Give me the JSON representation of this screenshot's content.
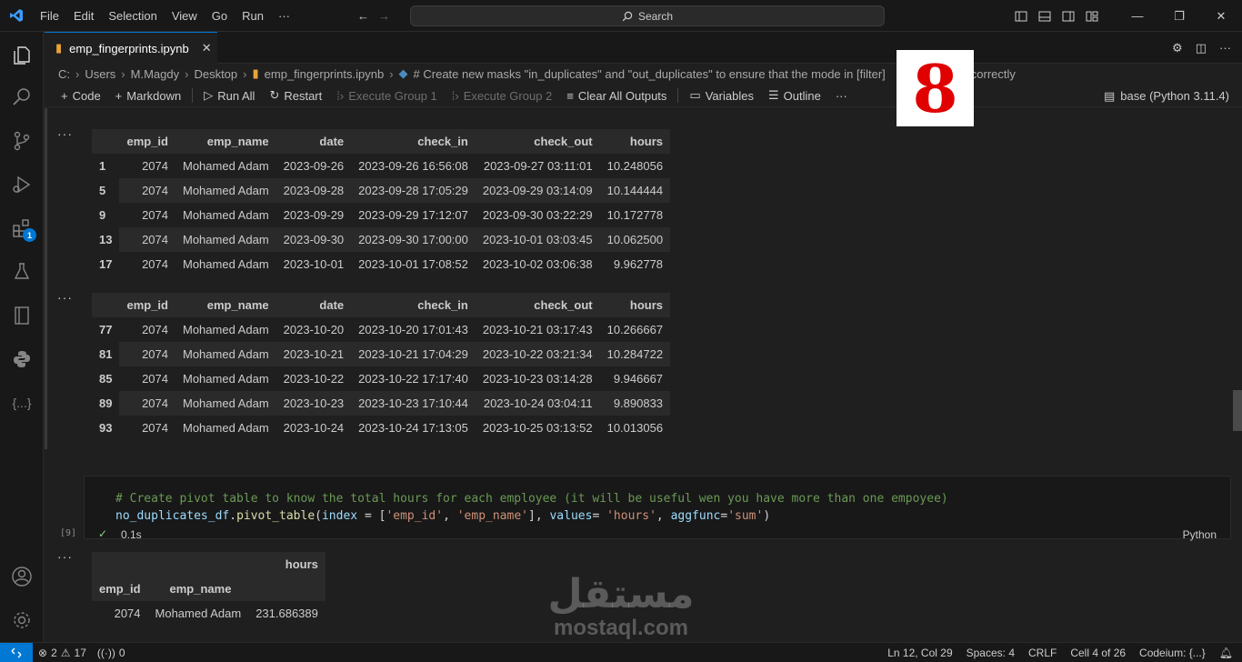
{
  "menu": [
    "File",
    "Edit",
    "Selection",
    "View",
    "Go",
    "Run",
    "···"
  ],
  "search": {
    "label": "Search"
  },
  "tab": {
    "filename": "emp_fingerprints.ipynb"
  },
  "breadcrumb": {
    "parts": [
      "C:",
      "Users",
      "M.Magdy",
      "Desktop",
      "emp_fingerprints.ipynb"
    ],
    "cell": "# Create new masks \"in_duplicates\" and \"out_duplicates\" to ensure that the mode in [filter]",
    "tail": "correctly"
  },
  "toolbar": {
    "code": "Code",
    "markdown": "Markdown",
    "run_all": "Run All",
    "restart": "Restart",
    "exec_group_1": "Execute Group 1",
    "exec_group_2": "Execute Group 2",
    "clear_outputs": "Clear All Outputs",
    "variables": "Variables",
    "outline": "Outline",
    "more": "···",
    "kernel": "base (Python 3.11.4)"
  },
  "badge_number": "8",
  "df_columns": [
    "",
    "emp_id",
    "emp_name",
    "date",
    "check_in",
    "check_out",
    "hours"
  ],
  "table1": [
    [
      "1",
      "2074",
      "Mohamed Adam",
      "2023-09-26",
      "2023-09-26 16:56:08",
      "2023-09-27 03:11:01",
      "10.248056"
    ],
    [
      "5",
      "2074",
      "Mohamed Adam",
      "2023-09-28",
      "2023-09-28 17:05:29",
      "2023-09-29 03:14:09",
      "10.144444"
    ],
    [
      "9",
      "2074",
      "Mohamed Adam",
      "2023-09-29",
      "2023-09-29 17:12:07",
      "2023-09-30 03:22:29",
      "10.172778"
    ],
    [
      "13",
      "2074",
      "Mohamed Adam",
      "2023-09-30",
      "2023-09-30 17:00:00",
      "2023-10-01 03:03:45",
      "10.062500"
    ],
    [
      "17",
      "2074",
      "Mohamed Adam",
      "2023-10-01",
      "2023-10-01 17:08:52",
      "2023-10-02 03:06:38",
      "9.962778"
    ]
  ],
  "table2": [
    [
      "77",
      "2074",
      "Mohamed Adam",
      "2023-10-20",
      "2023-10-20 17:01:43",
      "2023-10-21 03:17:43",
      "10.266667"
    ],
    [
      "81",
      "2074",
      "Mohamed Adam",
      "2023-10-21",
      "2023-10-21 17:04:29",
      "2023-10-22 03:21:34",
      "10.284722"
    ],
    [
      "85",
      "2074",
      "Mohamed Adam",
      "2023-10-22",
      "2023-10-22 17:17:40",
      "2023-10-23 03:14:28",
      "9.946667"
    ],
    [
      "89",
      "2074",
      "Mohamed Adam",
      "2023-10-23",
      "2023-10-23 17:10:44",
      "2023-10-24 03:04:11",
      "9.890833"
    ],
    [
      "93",
      "2074",
      "Mohamed Adam",
      "2023-10-24",
      "2023-10-24 17:13:05",
      "2023-10-25 03:13:52",
      "10.013056"
    ]
  ],
  "code_cell": {
    "comment": "# Create pivot table to know the total hours for each employee (it will be useful wen you have more than one empoyee)",
    "line2": {
      "obj": "no_duplicates_df",
      "dot": ".",
      "fn": "pivot_table",
      "p1": "(",
      "k1": "index",
      "eq1": " = [",
      "s1": "'emp_id'",
      "c1": ", ",
      "s2": "'emp_name'",
      "p2": "], ",
      "k2": "values",
      "eq2": "= ",
      "s3": "'hours'",
      "c2": ", ",
      "k3": "aggfunc",
      "eq3": "=",
      "s4": "'sum'",
      "p3": ")"
    },
    "exec_count": "[9]",
    "duration": "0.1s",
    "language": "Python"
  },
  "pivot": {
    "value_header": "hours",
    "index_headers": [
      "emp_id",
      "emp_name"
    ],
    "row": [
      "2074",
      "Mohamed Adam",
      "231.686389"
    ]
  },
  "watermark": {
    "arabic": "مستقل",
    "latin": "mostaql.com"
  },
  "status": {
    "errors": "2",
    "warnings": "17",
    "ports": "0",
    "position": "Ln 12, Col 29",
    "spaces": "Spaces: 4",
    "eol": "CRLF",
    "cell": "Cell 4 of 26",
    "codeium": "Codeium: {...}"
  },
  "colors": {
    "accent": "#0078d4",
    "badge_red": "#e00000",
    "comment": "#6a9955",
    "string": "#ce9178"
  }
}
